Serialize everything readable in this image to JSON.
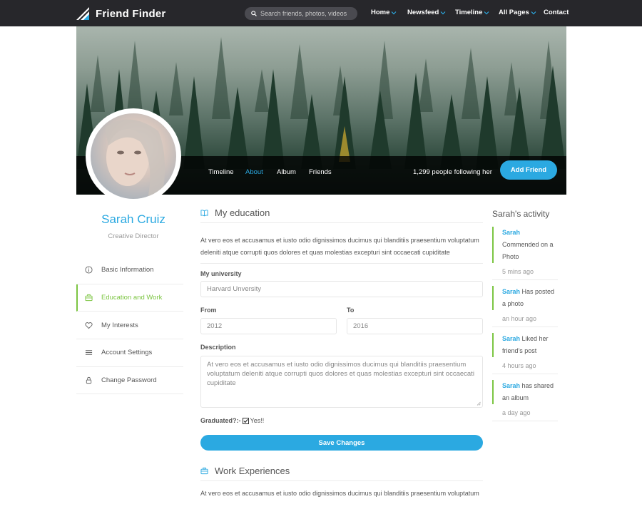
{
  "app": {
    "name": "Friend Finder"
  },
  "search": {
    "placeholder": "Search friends, photos, videos"
  },
  "nav": [
    {
      "label": "Home",
      "dropdown": true
    },
    {
      "label": "Newsfeed",
      "dropdown": true
    },
    {
      "label": "Timeline",
      "dropdown": true
    },
    {
      "label": "All Pages",
      "dropdown": true
    },
    {
      "label": "Contact",
      "dropdown": false
    }
  ],
  "cover": {
    "tabs": [
      "Timeline",
      "About",
      "Album",
      "Friends"
    ],
    "active_tab": "About",
    "followers_text": "1,299 people following her",
    "add_friend_label": "Add Friend"
  },
  "profile": {
    "name": "Sarah Cruiz",
    "role": "Creative Director"
  },
  "sidebar": {
    "items": [
      {
        "label": "Basic Information",
        "icon": "info-icon"
      },
      {
        "label": "Education and Work",
        "icon": "briefcase-icon",
        "active": true
      },
      {
        "label": "My Interests",
        "icon": "heart-icon"
      },
      {
        "label": "Account Settings",
        "icon": "menu-icon"
      },
      {
        "label": "Change Password",
        "icon": "lock-icon"
      }
    ]
  },
  "education": {
    "title": "My education",
    "intro": "At vero eos et accusamus et iusto odio dignissimos ducimus qui blanditiis praesentium voluptatum deleniti atque corrupti quos dolores et quas molestias excepturi sint occaecati cupiditate",
    "university_label": "My university",
    "university_value": "Harvard Unversity",
    "from_label": "From",
    "from_value": "2012",
    "to_label": "To",
    "to_value": "2016",
    "description_label": "Description",
    "description_value": "At vero eos et accusamus et iusto odio dignissimos ducimus qui blanditiis praesentium voluptatum deleniti atque corrupti quos dolores et quas molestias excepturi sint occaecati cupiditate",
    "graduated_label": "Graduated?:-",
    "graduated_option": "Yes!!",
    "graduated_checked": true,
    "save_label": "Save Changes"
  },
  "work": {
    "title": "Work Experiences",
    "intro": "At vero eos et accusamus et iusto odio dignissimos ducimus qui blanditiis praesentium voluptatum"
  },
  "activity": {
    "title": "Sarah's activity",
    "items": [
      {
        "who": "Sarah",
        "text": " Commended on a Photo",
        "time": "5 mins ago"
      },
      {
        "who": "Sarah",
        "text": " Has posted a photo",
        "time": "an hour ago"
      },
      {
        "who": "Sarah",
        "text": " Liked her friend's post",
        "time": "4 hours ago"
      },
      {
        "who": "Sarah",
        "text": " has shared an album",
        "time": "a day ago"
      }
    ]
  },
  "colors": {
    "accent": "#2ba9e1",
    "green": "#7cc542",
    "topbar": "#27272b"
  }
}
